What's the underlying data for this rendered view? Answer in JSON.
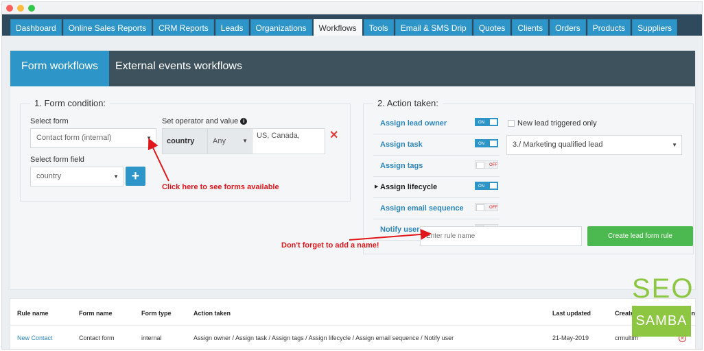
{
  "nav": {
    "items": [
      {
        "label": "Dashboard",
        "active": false
      },
      {
        "label": "Online Sales Reports",
        "active": false
      },
      {
        "label": "CRM Reports",
        "active": false
      },
      {
        "label": "Leads",
        "active": false
      },
      {
        "label": "Organizations",
        "active": false
      },
      {
        "label": "Workflows",
        "active": true
      },
      {
        "label": "Tools",
        "active": false
      },
      {
        "label": "Email & SMS Drip",
        "active": false
      },
      {
        "label": "Quotes",
        "active": false
      },
      {
        "label": "Clients",
        "active": false
      },
      {
        "label": "Orders",
        "active": false
      },
      {
        "label": "Products",
        "active": false
      },
      {
        "label": "Suppliers",
        "active": false
      }
    ]
  },
  "tabs": {
    "active": "Form workflows",
    "inactive": "External events workflows"
  },
  "condition": {
    "title": "1. Form condition:",
    "select_form_label": "Select form",
    "select_form_value": "Contact form (internal)",
    "operator_label": "Set operator and value",
    "field_name": "country",
    "operator_value": "Any",
    "value_text": "US, Canada,",
    "select_field_label": "Select form field",
    "select_field_value": "country",
    "add_symbol": "+",
    "remove_symbol": "✕"
  },
  "action": {
    "title": "2. Action taken:",
    "rows": [
      {
        "label": "Assign lead owner",
        "state": "ON",
        "on": true,
        "current": false
      },
      {
        "label": "Assign task",
        "state": "ON",
        "on": true,
        "current": false
      },
      {
        "label": "Assign tags",
        "state": "OFF",
        "on": false,
        "current": false
      },
      {
        "label": "Assign lifecycle",
        "state": "ON",
        "on": true,
        "current": true
      },
      {
        "label": "Assign email sequence",
        "state": "OFF",
        "on": false,
        "current": false
      },
      {
        "label": "Notify user",
        "state": "OFF",
        "on": false,
        "current": false
      }
    ],
    "new_lead_label": "New lead triggered only",
    "lifecycle_value": "3./ Marketing qualified lead"
  },
  "rule": {
    "placeholder": "Enter rule name",
    "create_label": "Create lead form rule"
  },
  "annotations": {
    "forms_hint": "Click here to see forms available",
    "name_hint": "Don't forget to add a name!"
  },
  "table": {
    "headers": [
      "Rule name",
      "Form name",
      "Form type",
      "Action taken",
      "Last updated",
      "Created by",
      "Action"
    ],
    "row": {
      "rule_name": "New Contact",
      "form_name": "Contact form",
      "form_type": "internal",
      "action_taken": "Assign owner / Assign task / Assign tags / Assign lifecycle / Assign email sequence / Notify user",
      "last_updated": "21-May-2019",
      "created_by": "crmultim"
    }
  },
  "watermark": {
    "top": "SEO",
    "bottom": "SAMBA"
  },
  "colors": {
    "nav_bg": "#2e4a5c",
    "accent": "#2e95c9",
    "tabbar_bg": "#3e525e",
    "create_button": "#4cb950",
    "annotation": "#e0161b",
    "seo_green": "#8dc640"
  }
}
